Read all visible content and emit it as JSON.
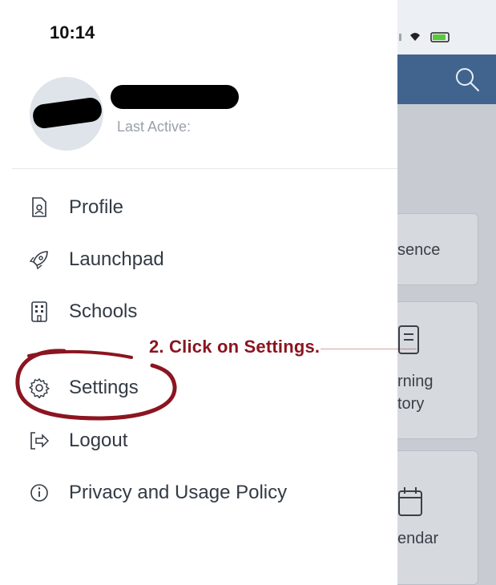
{
  "status_bar": {
    "time": "10:14"
  },
  "profile": {
    "last_active_label": "Last Active:"
  },
  "menu": {
    "items": [
      {
        "label": "Profile",
        "icon": "profile-icon"
      },
      {
        "label": "Launchpad",
        "icon": "rocket-icon"
      },
      {
        "label": "Schools",
        "icon": "building-icon"
      },
      {
        "label": "Settings",
        "icon": "gear-icon"
      },
      {
        "label": "Logout",
        "icon": "logout-icon"
      },
      {
        "label": "Privacy and Usage Policy",
        "icon": "info-icon"
      }
    ]
  },
  "annotation": {
    "text": "2.  Click on Settings.",
    "color": "#8b1520"
  },
  "background_app": {
    "header_color": "#41648f",
    "card_texts": [
      "sence",
      "rning",
      "tory",
      "endar"
    ]
  }
}
